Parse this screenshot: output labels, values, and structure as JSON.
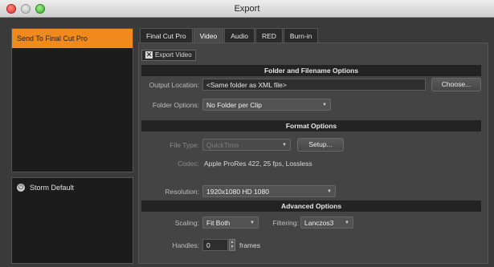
{
  "window": {
    "title": "Export"
  },
  "presets": {
    "selected": "Send To Final Cut Pro",
    "other": "Storm Default"
  },
  "tabs": [
    "Final Cut Pro",
    "Video",
    "Audio",
    "RED",
    "Burn-in"
  ],
  "export_video": {
    "label": "Export Video",
    "checked": true
  },
  "folder_section": {
    "header": "Folder and Filename Options",
    "output_label": "Output Location:",
    "output_value": "<Same folder as XML file>",
    "choose_button": "Choose...",
    "folder_options_label": "Folder Options:",
    "folder_options_value": "No Folder per Clip"
  },
  "format_section": {
    "header": "Format Options",
    "file_type_label": "File Type:",
    "file_type_value": "QuickTime",
    "setup_button": "Setup...",
    "codec_label": "Codec:",
    "codec_value": "Apple ProRes 422, 25 fps, Lossless",
    "resolution_label": "Resolution:",
    "resolution_value": "1920x1080 HD 1080"
  },
  "advanced_section": {
    "header": "Advanced Options",
    "scaling_label": "Scaling:",
    "scaling_value": "Fit Both",
    "filtering_label": "Filtering:",
    "filtering_value": "Lanczos3",
    "handles_label": "Handles:",
    "handles_value": "0",
    "handles_unit": "frames"
  }
}
